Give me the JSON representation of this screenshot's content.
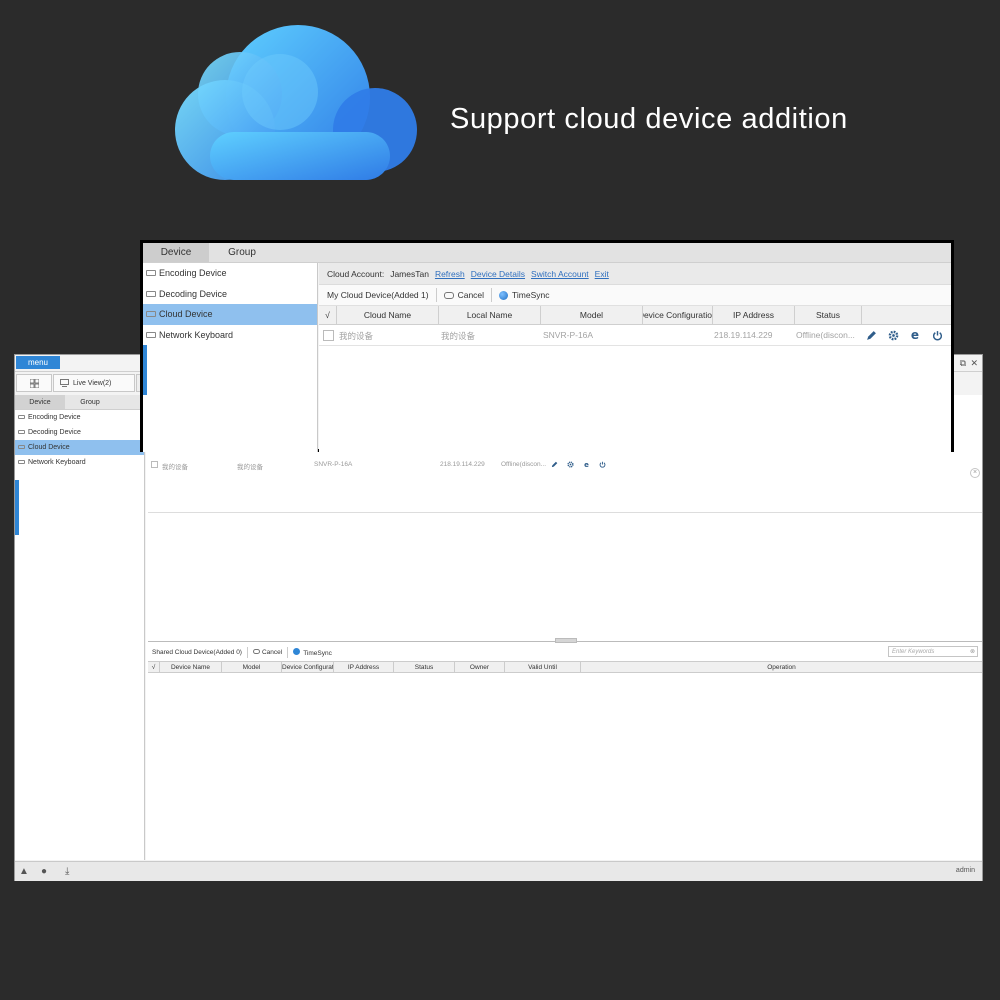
{
  "headline": "Support cloud device addition",
  "colors": {
    "accent": "#2f86d6",
    "selection": "#8fc0ee",
    "link": "#2f6fbe",
    "background": "#2b2b2b"
  },
  "icons": [
    "cloud-icon",
    "grid-icon",
    "monitor-icon",
    "warning-icon",
    "chat-icon",
    "download-icon",
    "edit-icon",
    "gear-icon",
    "browser-icon",
    "power-icon"
  ],
  "background_window": {
    "menu_label": "menu",
    "tab_label": "Live View(2)",
    "sidebar_tabs": [
      "Device",
      "Group"
    ],
    "sidebar_items": [
      "Encoding Device",
      "Decoding Device",
      "Cloud Device",
      "Network Keyboard"
    ],
    "row": {
      "cloud_name": "我的设备",
      "local_name": "我的设备",
      "model": "SNVR-P-16A",
      "ip": "218.19.114.229",
      "status": "Offline(discon..."
    },
    "shared_toolbar": {
      "title": "Shared Cloud Device(Added 0)",
      "cancel": "Cancel",
      "timesync": "TimeSync",
      "search_placeholder": "Enter Keywords"
    },
    "shared_columns": [
      "√",
      "Device Name",
      "Model",
      "Device Configuratio",
      "IP Address",
      "Status",
      "Owner",
      "Valid Until",
      "Operation"
    ],
    "user": "admin"
  },
  "foreground_window": {
    "tabs": [
      "Device",
      "Group"
    ],
    "sidebar_items": [
      "Encoding Device",
      "Decoding Device",
      "Cloud Device",
      "Network Keyboard"
    ],
    "account_label": "Cloud Account:",
    "account_name": "JamesTan",
    "links": [
      "Refresh",
      "Device Details",
      "Switch Account",
      "Exit"
    ],
    "toolbar": {
      "title": "My Cloud Device(Added 1)",
      "cancel": "Cancel",
      "timesync": "TimeSync"
    },
    "columns": [
      "√",
      "Cloud Name",
      "Local Name",
      "Model",
      "Device Configuratio",
      "IP Address",
      "Status"
    ],
    "row": {
      "cloud_name": "我的设备",
      "local_name": "我的设备",
      "model": "SNVR-P-16A",
      "ip": "218.19.114.229",
      "status": "Offline(discon..."
    }
  }
}
